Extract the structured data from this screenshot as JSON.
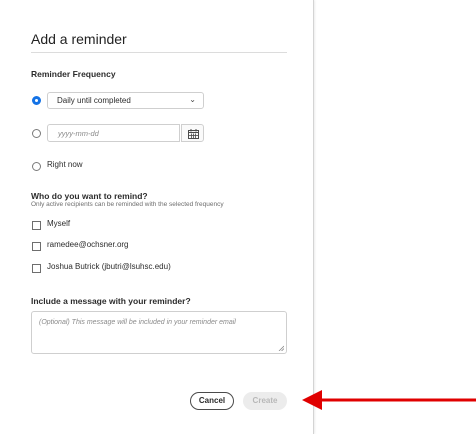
{
  "dialog": {
    "title": "Add a reminder",
    "frequency": {
      "section_label": "Reminder Frequency",
      "options": [
        {
          "type": "select",
          "value": "Daily until completed",
          "checked": true
        },
        {
          "type": "date",
          "placeholder": "yyyy-mm-dd",
          "checked": false
        },
        {
          "type": "text",
          "label": "Right now",
          "checked": false
        }
      ]
    },
    "recipients": {
      "section_label": "Who do you want to remind?",
      "note": "Only active recipients can be reminded with the selected frequency",
      "items": [
        {
          "label": "Myself",
          "checked": false
        },
        {
          "label": "ramedee@ochsner.org",
          "checked": false
        },
        {
          "label": "Joshua Butrick (jbutri@lsuhsc.edu)",
          "checked": false
        }
      ]
    },
    "message": {
      "section_label": "Include a message with your reminder?",
      "placeholder": "(Optional) This message will be included in your reminder email"
    },
    "buttons": {
      "cancel": "Cancel",
      "create": "Create"
    }
  },
  "colors": {
    "accent": "#1473e6",
    "annotation_arrow": "#e00000"
  },
  "icons": {
    "calendar": "calendar-icon",
    "dropdown": "chevron-down-icon"
  }
}
